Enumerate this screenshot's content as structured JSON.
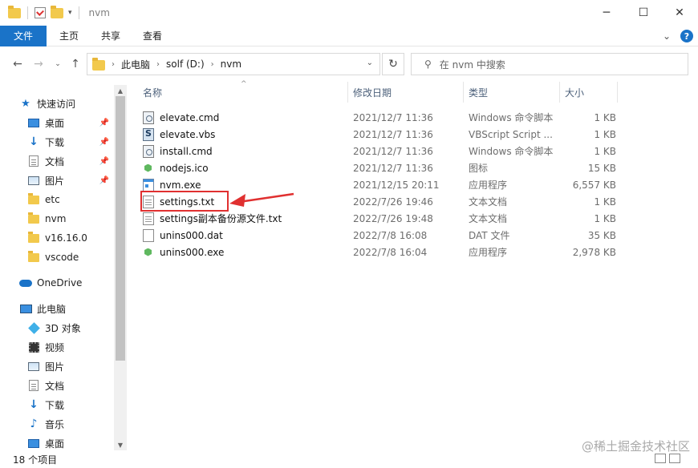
{
  "window": {
    "title": "nvm",
    "controls": {
      "minimize": "─",
      "maximize": "☐",
      "close": "✕"
    }
  },
  "ribbon": {
    "tabs": [
      "文件",
      "主页",
      "共享",
      "查看"
    ],
    "expand_glyph": "⌄",
    "help_glyph": "?"
  },
  "nav": {
    "back": "←",
    "forward": "→",
    "recent": "⌄",
    "up": "↑",
    "breadcrumb": [
      "此电脑",
      "solf (D:)",
      "nvm"
    ],
    "refresh": "↻",
    "search_placeholder": "在 nvm 中搜索"
  },
  "sidebar": {
    "items": [
      {
        "label": "快速访问",
        "icon": "star-icon",
        "pinned": false
      },
      {
        "label": "桌面",
        "icon": "desktop-icon",
        "pinned": true
      },
      {
        "label": "下载",
        "icon": "download-icon",
        "pinned": true
      },
      {
        "label": "文档",
        "icon": "document-icon",
        "pinned": true
      },
      {
        "label": "图片",
        "icon": "picture-icon",
        "pinned": true
      },
      {
        "label": "etc",
        "icon": "folder-icon",
        "pinned": false
      },
      {
        "label": "nvm",
        "icon": "folder-icon",
        "pinned": false
      },
      {
        "label": "v16.16.0",
        "icon": "folder-icon",
        "pinned": false
      },
      {
        "label": "vscode",
        "icon": "folder-icon",
        "pinned": false
      },
      {
        "label": "OneDrive",
        "icon": "cloud-icon",
        "pinned": false
      },
      {
        "label": "此电脑",
        "icon": "computer-icon",
        "pinned": false
      },
      {
        "label": "3D 对象",
        "icon": "3d-objects-icon",
        "pinned": false
      },
      {
        "label": "视频",
        "icon": "video-icon",
        "pinned": false
      },
      {
        "label": "图片",
        "icon": "picture-icon",
        "pinned": false
      },
      {
        "label": "文档",
        "icon": "document-icon",
        "pinned": false
      },
      {
        "label": "下载",
        "icon": "download-icon",
        "pinned": false
      },
      {
        "label": "音乐",
        "icon": "music-icon",
        "pinned": false
      },
      {
        "label": "桌面",
        "icon": "desktop-icon",
        "pinned": false
      }
    ]
  },
  "columns": {
    "name": "名称",
    "date": "修改日期",
    "type": "类型",
    "size": "大小"
  },
  "files": [
    {
      "name": "elevate.cmd",
      "date": "2021/12/7 11:36",
      "type": "Windows 命令脚本",
      "size": "1 KB",
      "icon": "cmd-file-icon"
    },
    {
      "name": "elevate.vbs",
      "date": "2021/12/7 11:36",
      "type": "VBScript Script ...",
      "size": "1 KB",
      "icon": "vbs-file-icon"
    },
    {
      "name": "install.cmd",
      "date": "2021/12/7 11:36",
      "type": "Windows 命令脚本",
      "size": "1 KB",
      "icon": "cmd-file-icon"
    },
    {
      "name": "nodejs.ico",
      "date": "2021/12/7 11:36",
      "type": "图标",
      "size": "15 KB",
      "icon": "nodejs-icon"
    },
    {
      "name": "nvm.exe",
      "date": "2021/12/15 20:11",
      "type": "应用程序",
      "size": "6,557 KB",
      "icon": "exe-file-icon"
    },
    {
      "name": "settings.txt",
      "date": "2022/7/26 19:46",
      "type": "文本文档",
      "size": "1 KB",
      "icon": "text-file-icon"
    },
    {
      "name": "settings副本备份源文件.txt",
      "date": "2022/7/26 19:48",
      "type": "文本文档",
      "size": "1 KB",
      "icon": "text-file-icon"
    },
    {
      "name": "unins000.dat",
      "date": "2022/7/8 16:08",
      "type": "DAT 文件",
      "size": "35 KB",
      "icon": "dat-file-icon"
    },
    {
      "name": "unins000.exe",
      "date": "2022/7/8 16:04",
      "type": "应用程序",
      "size": "2,978 KB",
      "icon": "nodejs-icon"
    }
  ],
  "status": {
    "count": "18 个项目"
  },
  "watermark": "@稀土掘金技术社区",
  "colors": {
    "accent": "#1a73c8",
    "annotation": "#e03030"
  }
}
